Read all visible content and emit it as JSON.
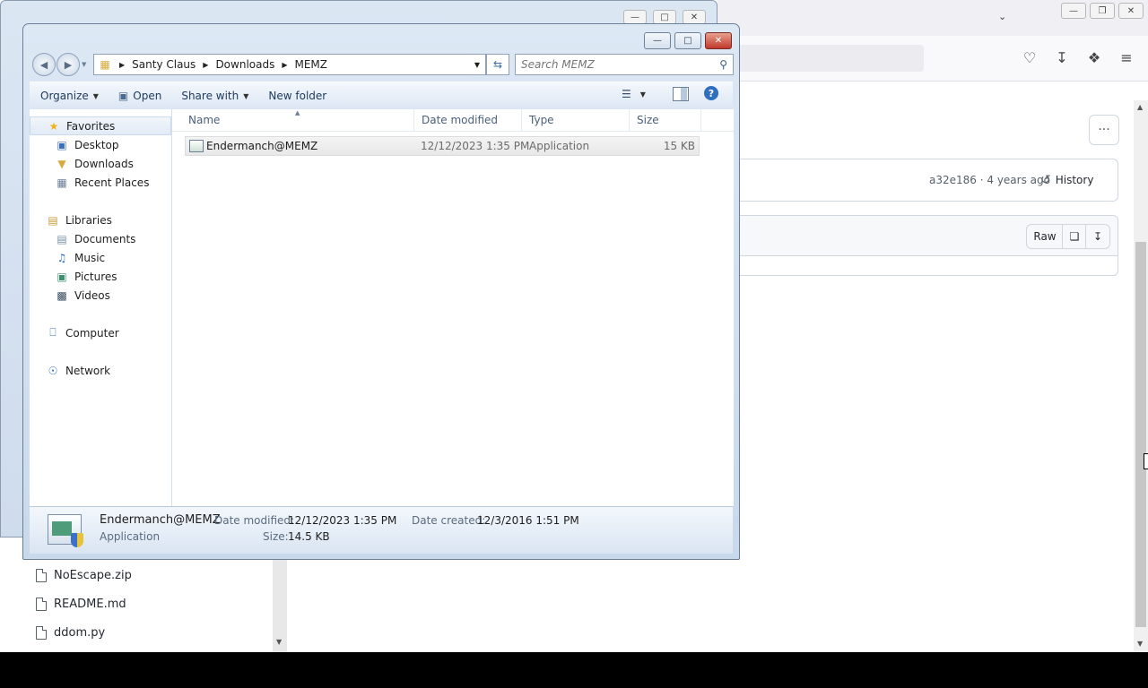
{
  "browser": {
    "page": {
      "commit_sha": "a32e186",
      "commit_time": "4 years ago",
      "history_label": "History",
      "raw_label": "Raw"
    },
    "left_files": [
      "NoEscape.zip",
      "README.md",
      "ddom.py"
    ]
  },
  "explorer": {
    "breadcrumb": [
      "Santy Claus",
      "Downloads",
      "MEMZ"
    ],
    "search_placeholder": "Search MEMZ",
    "commands": {
      "organize": "Organize",
      "open": "Open",
      "share_with": "Share with",
      "new_folder": "New folder"
    },
    "nav": {
      "favorites": "Favorites",
      "desktop": "Desktop",
      "downloads": "Downloads",
      "recent_places": "Recent Places",
      "libraries": "Libraries",
      "documents": "Documents",
      "music": "Music",
      "pictures": "Pictures",
      "videos": "Videos",
      "computer": "Computer",
      "network": "Network"
    },
    "columns": {
      "name": "Name",
      "date_modified": "Date modified",
      "type": "Type",
      "size": "Size"
    },
    "files": [
      {
        "name": "Endermanch@MEMZ",
        "date_modified": "12/12/2023 1:35 PM",
        "type": "Application",
        "size": "15 KB"
      }
    ],
    "details": {
      "name": "Endermanch@MEMZ",
      "type": "Application",
      "date_modified_label": "Date modified:",
      "date_modified": "12/12/2023 1:35 PM",
      "date_created_label": "Date created:",
      "date_created": "12/3/2016 1:51 PM",
      "size_label": "Size:",
      "size": "14.5 KB"
    }
  }
}
